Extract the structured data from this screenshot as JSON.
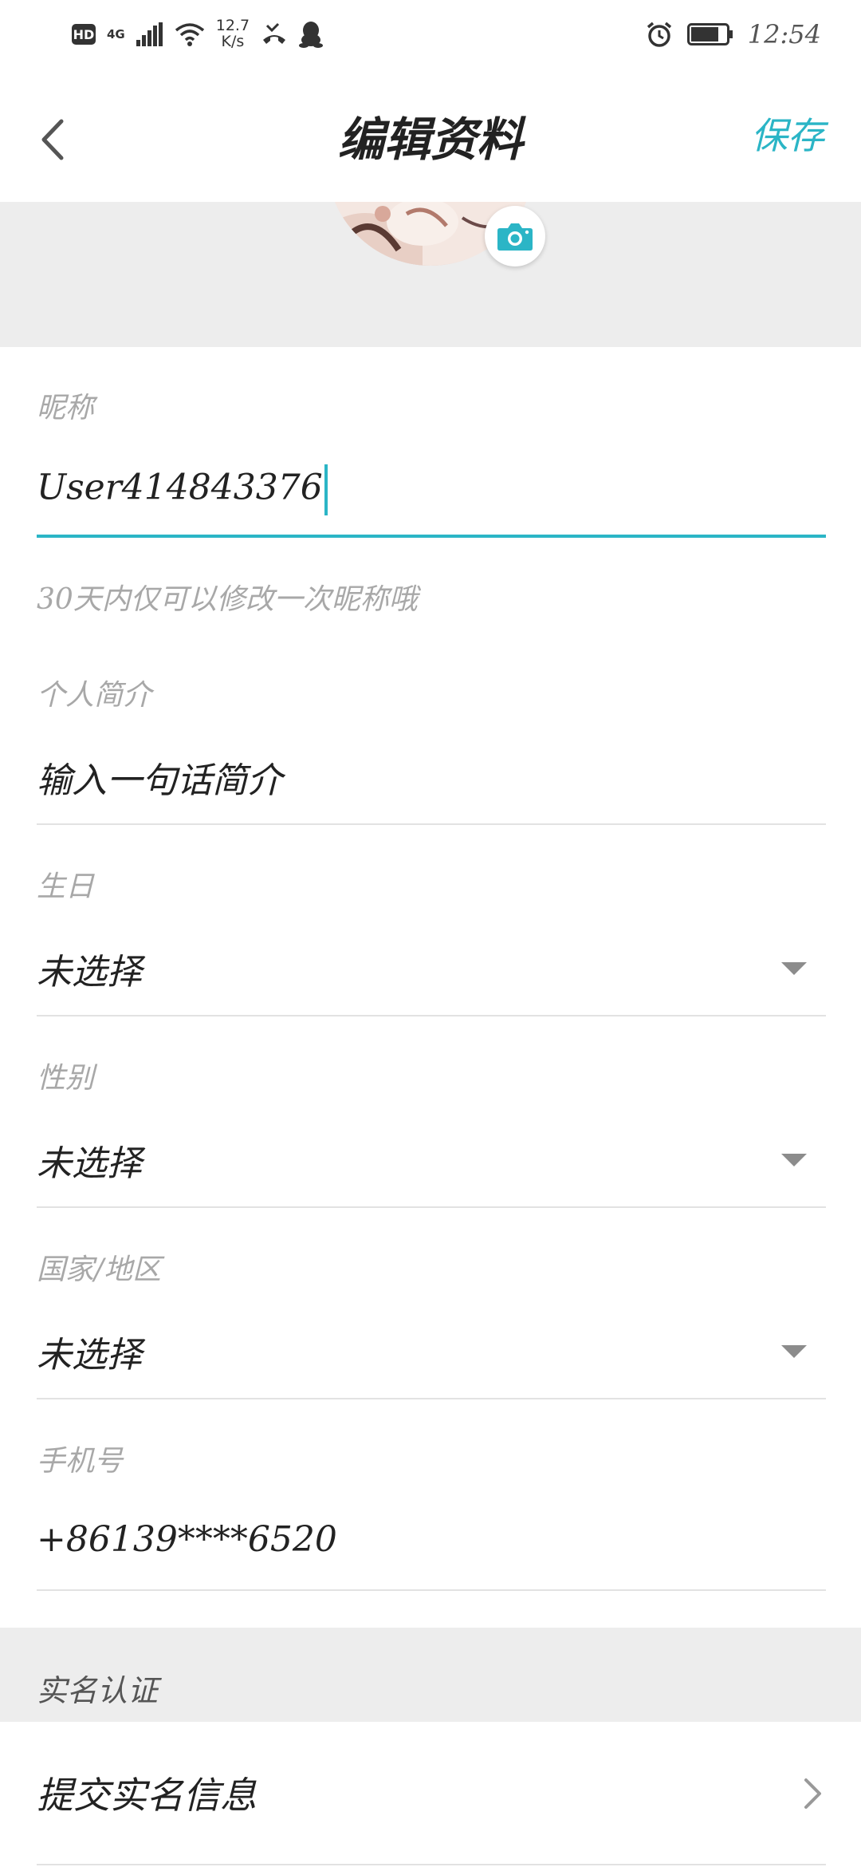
{
  "status_bar": {
    "hd": "HD",
    "network": "4G",
    "speed_value": "12.7",
    "speed_unit": "K/s",
    "time": "12:54"
  },
  "header": {
    "title": "编辑资料",
    "save_label": "保存"
  },
  "form": {
    "nickname": {
      "label": "昵称",
      "value": "User414843376",
      "hint": "30天内仅可以修改一次昵称哦"
    },
    "bio": {
      "label": "个人简介",
      "placeholder": "输入一句话简介"
    },
    "birthday": {
      "label": "生日",
      "value": "未选择"
    },
    "gender": {
      "label": "性别",
      "value": "未选择"
    },
    "region": {
      "label": "国家/地区",
      "value": "未选择"
    },
    "phone": {
      "label": "手机号",
      "value": "+86139****6520"
    }
  },
  "verification": {
    "section_title": "实名认证",
    "submit_label": "提交实名信息"
  },
  "colors": {
    "accent": "#2bb5c6",
    "section_bg": "#ededed",
    "label_gray": "#a8a8a8"
  }
}
